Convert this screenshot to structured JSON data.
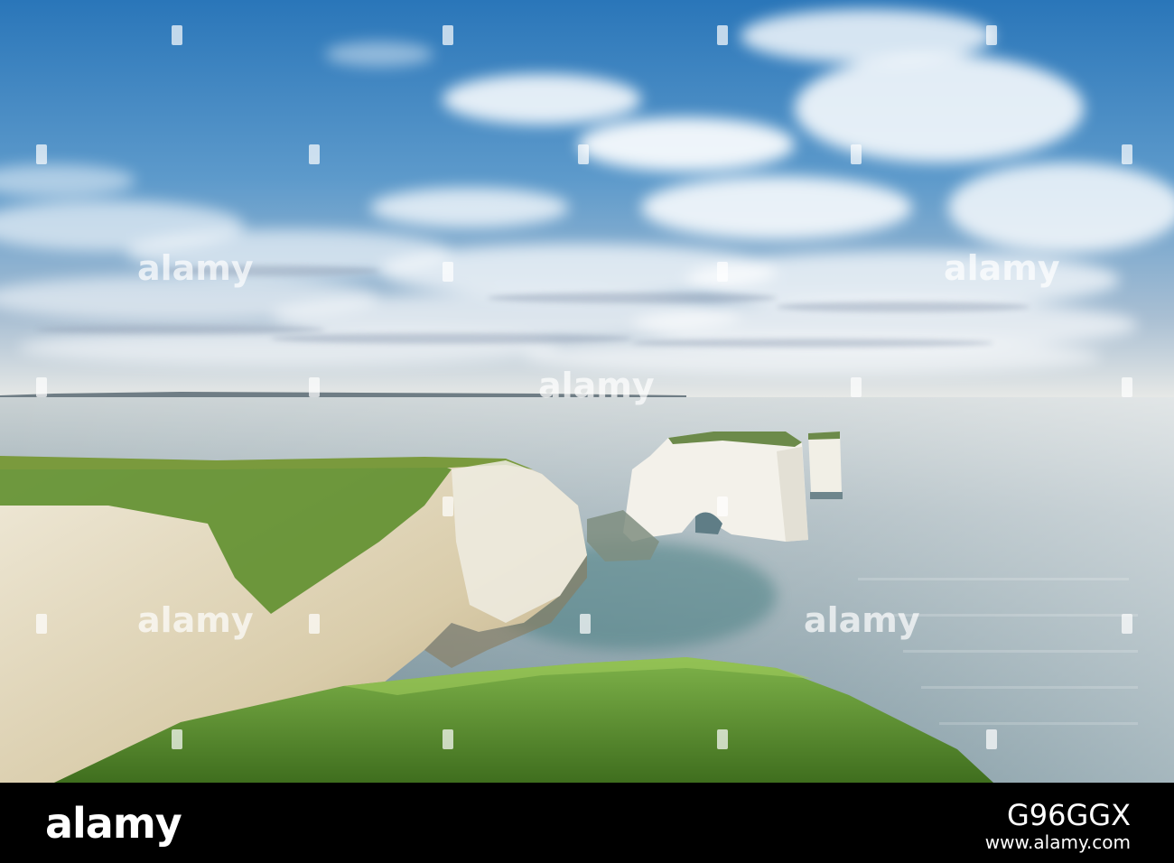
{
  "watermark": {
    "logo_text": "alamy",
    "image_id": "G96GGX",
    "site_url": "www.alamy.com"
  },
  "scene": {
    "subject": "white chalk cliffs and sea stacks on a calm sea under a cloudy blue sky",
    "colors": {
      "sky_top": "#2f7fc0",
      "sky_mid": "#6aa3cf",
      "horizon": "#e8ecee",
      "sea": "#8fa3ad",
      "sea_dark": "#3d5f6b",
      "chalk": "#f2f0e8",
      "grass": "#5f8f2e",
      "footer": "#000000"
    }
  }
}
